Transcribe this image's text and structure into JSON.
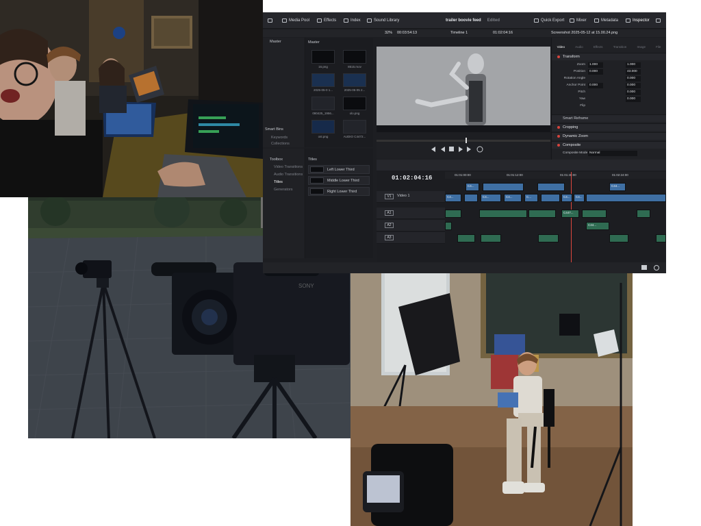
{
  "resolve": {
    "project_title": "trailer boovie feed",
    "edited_label": "Edited",
    "top_tabs": [
      "Media Pool",
      "Effects",
      "Index",
      "Sound Library"
    ],
    "right_tabs": [
      "Quick Export",
      "Mixer",
      "Metadata",
      "Inspector"
    ],
    "toolbar": {
      "zoom": "32%",
      "duration": "00:03:54:13",
      "timeline_select": "Timeline 1",
      "source_tc": "01:02:04:16",
      "clip_name": "Screenshot 2025-05-12 at 15.00.24.png"
    },
    "media_pool": {
      "bin_header": "Master",
      "grid_header": "Master",
      "smart_bins": "Smart Bins",
      "bins": [
        "Keywords",
        "Collections"
      ],
      "thumbnails": [
        {
          "label": "16.png"
        },
        {
          "label": "8515.mov"
        },
        {
          "label": "2025-05-0 1..."
        },
        {
          "label": "2025-05-05 2..."
        },
        {
          "label": "080425_1956..."
        },
        {
          "label": "olo.png"
        },
        {
          "label": "ost.png"
        },
        {
          "label": "AUDIO C4472..."
        }
      ]
    },
    "effects": {
      "toolbox": "Toolbox",
      "tree": [
        "Video Transitions",
        "Audio Transitions",
        "Titles",
        "Generators"
      ],
      "list_header": "Titles",
      "items": [
        "Left Lower Third",
        "Middle Lower Third",
        "Right Lower Third"
      ]
    },
    "inspector": {
      "tabs": [
        "Video",
        "Audio",
        "Effects",
        "Transition",
        "Image",
        "File"
      ],
      "transform_label": "Transform",
      "rows": [
        {
          "k": "Zoom",
          "v1": "1.000",
          "v2": "1.000"
        },
        {
          "k": "Position",
          "v1": "0.000",
          "v2": "43.000"
        },
        {
          "k": "Rotation Angle",
          "v1": "",
          "v2": "0.000"
        },
        {
          "k": "Anchor Point",
          "v1": "0.000",
          "v2": "0.000"
        },
        {
          "k": "Pitch",
          "v1": "",
          "v2": "0.000"
        },
        {
          "k": "Yaw",
          "v1": "",
          "v2": "0.000"
        },
        {
          "k": "Flip",
          "v1": "",
          "v2": ""
        }
      ],
      "sections": [
        "Smart Reframe",
        "Cropping",
        "Dynamic Zoom",
        "Composite"
      ],
      "composite_mode_label": "Composite Mode",
      "composite_mode_value": "Normal"
    },
    "timeline": {
      "timecode": "01:02:04:16",
      "ruler": [
        "01:01:00:00",
        "01:01:12:00",
        "01:01:48:00",
        "01:02:24:00"
      ],
      "tracks": [
        {
          "tag": "V1",
          "name": "Video 1"
        },
        {
          "tag": "A1",
          "name": ""
        },
        {
          "tag": "A2",
          "name": ""
        },
        {
          "tag": "A3",
          "name": ""
        }
      ],
      "video_clips": [
        "C4...",
        "C44...",
        "C4...",
        "C4...",
        "C4...",
        "C447...",
        "C4...",
        "C...",
        "C4...",
        "C4..."
      ],
      "audio_clips": [
        "C447...",
        "C44..."
      ]
    }
  }
}
